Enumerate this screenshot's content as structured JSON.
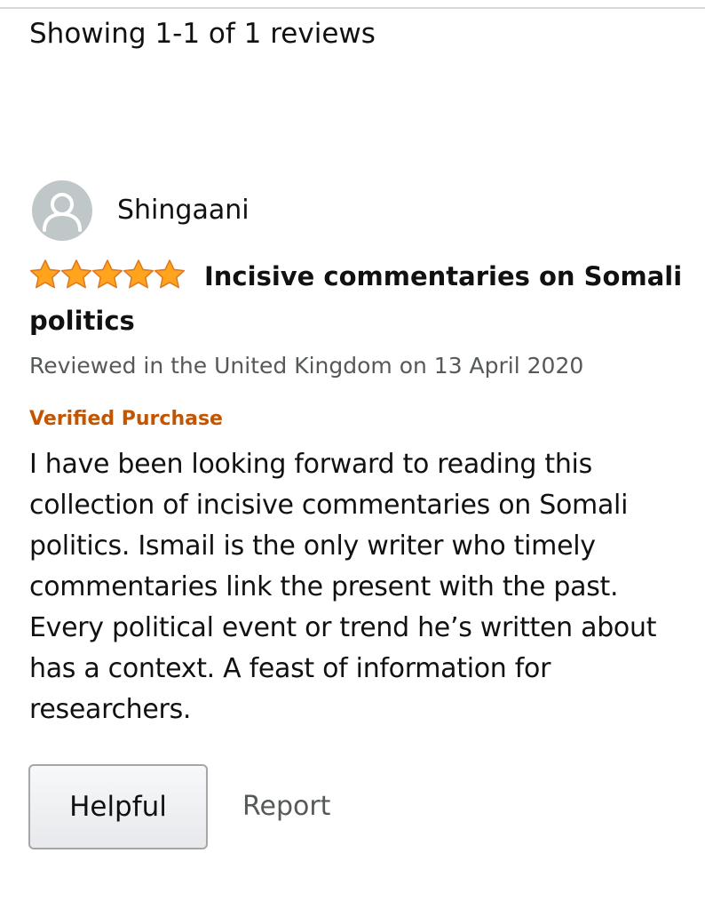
{
  "review_list": {
    "showing_text": "Showing 1-1 of 1 reviews"
  },
  "review": {
    "reviewer": {
      "name": "Shingaani",
      "avatar_icon": "default-avatar-icon"
    },
    "rating": {
      "value": 5,
      "max": 5,
      "star_color": "#ffa41c"
    },
    "title": "Incisive commentaries on Somali politics",
    "date_text": "Reviewed in the United Kingdom on 13 April 2020",
    "verified_label": "Verified Purchase",
    "verified_color": "#c45500",
    "body": "I have been looking forward to reading this collection of incisive commentaries on Somali politics. Ismail is the only writer who timely commentaries link the present with the past. Every political event or trend he’s written about has a context. A feast of information for researchers.",
    "actions": {
      "helpful_label": "Helpful",
      "report_label": "Report"
    }
  }
}
